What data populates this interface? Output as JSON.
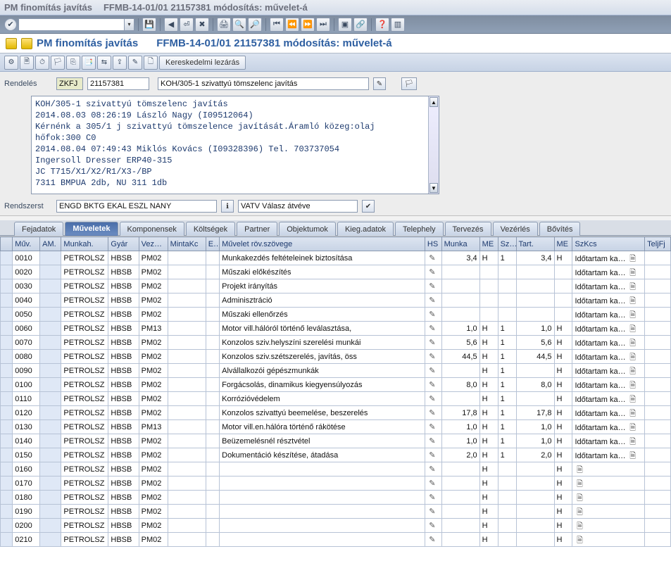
{
  "title": {
    "left": "PM finomítás javítás",
    "right": "FFMB-14-01/01 21157381 módosítás: művelet-á"
  },
  "screen": {
    "left": "PM finomítás javítás",
    "right": "FFMB-14-01/01 21157381 módosítás: művelet-á"
  },
  "toolbar2_text_btn": "Kereskedelmi lezárás",
  "order": {
    "label": "Rendelés",
    "type": "ZKFJ",
    "number": "21157381",
    "desc": "KOH/305-1 szivattyú tömszelenc javítás"
  },
  "longtext": "KOH/305-1 szivattyú tömszelenc javítás\n2014.08.03 08:26:19 László Nagy (I09512064)\nKérnénk a 305/1 j szivattyú tömszelence javítását.Áramló közeg:olaj\nhőfok:300 C0\n2014.08.04 07:49:43 Miklós Kovács (I09328396) Tel. 703737054\nIngersoll Dresser ERP40-315\nJC T715/X1/X2/R1/X3-/BP\n7311 BMPUA 2db, NU 311 1db",
  "system_row": {
    "label": "Rendszerst",
    "value": "ENGD BKTG EKAL ESZL NANY",
    "status": "VATV Válasz átvéve"
  },
  "tabs": [
    "Fejadatok",
    "Műveletek",
    "Komponensek",
    "Költségek",
    "Partner",
    "Objektumok",
    "Kieg.adatok",
    "Telephely",
    "Tervezés",
    "Vezérlés",
    "Bővítés"
  ],
  "tab_active": 1,
  "grid_headers": {
    "sel": "",
    "muv": "Műv.",
    "am": "AM.",
    "munkah": "Munkah.",
    "gyar": "Gyár",
    "vez": "Vez…",
    "mintakc": "MintaKc",
    "e": "E…",
    "szoveg": "Művelet röv.szövege",
    "hs": "HS",
    "munka": "Munka",
    "me1": "ME",
    "sz": "Sz…",
    "tart": "Tart.",
    "me2": "ME",
    "szkcs": "SzKcs",
    "teljfj": "TeljFj"
  },
  "rows": [
    {
      "muv": "0010",
      "munkah": "PETROLSZ",
      "gyar": "HBSB",
      "vez": "PM02",
      "szoveg": "Munkakezdés feltételeinek biztosítása",
      "munka": "3,4",
      "me1": "H",
      "sz": "1",
      "tart": "3,4",
      "me2": "H",
      "szkcs": "Időtartam ka…"
    },
    {
      "muv": "0020",
      "munkah": "PETROLSZ",
      "gyar": "HBSB",
      "vez": "PM02",
      "szoveg": "Műszaki előkészítés",
      "munka": "",
      "me1": "",
      "sz": "",
      "tart": "",
      "me2": "",
      "szkcs": "Időtartam ka…"
    },
    {
      "muv": "0030",
      "munkah": "PETROLSZ",
      "gyar": "HBSB",
      "vez": "PM02",
      "szoveg": "Projekt irányítás",
      "munka": "",
      "me1": "",
      "sz": "",
      "tart": "",
      "me2": "",
      "szkcs": "Időtartam ka…"
    },
    {
      "muv": "0040",
      "munkah": "PETROLSZ",
      "gyar": "HBSB",
      "vez": "PM02",
      "szoveg": "Adminisztráció",
      "munka": "",
      "me1": "",
      "sz": "",
      "tart": "",
      "me2": "",
      "szkcs": "Időtartam ka…"
    },
    {
      "muv": "0050",
      "munkah": "PETROLSZ",
      "gyar": "HBSB",
      "vez": "PM02",
      "szoveg": "Műszaki ellenőrzés",
      "munka": "",
      "me1": "",
      "sz": "",
      "tart": "",
      "me2": "",
      "szkcs": "Időtartam ka…"
    },
    {
      "muv": "0060",
      "munkah": "PETROLSZ",
      "gyar": "HBSB",
      "vez": "PM13",
      "szoveg": "Motor vill.hálóról történő leválasztása,",
      "munka": "1,0",
      "me1": "H",
      "sz": "1",
      "tart": "1,0",
      "me2": "H",
      "szkcs": "Időtartam ka…"
    },
    {
      "muv": "0070",
      "munkah": "PETROLSZ",
      "gyar": "HBSB",
      "vez": "PM02",
      "szoveg": "Konzolos sziv.helyszíni szerelési munkái",
      "munka": "5,6",
      "me1": "H",
      "sz": "1",
      "tart": "5,6",
      "me2": "H",
      "szkcs": "Időtartam ka…"
    },
    {
      "muv": "0080",
      "munkah": "PETROLSZ",
      "gyar": "HBSB",
      "vez": "PM02",
      "szoveg": "Konzolos sziv.szétszerelés, javítás, öss",
      "munka": "44,5",
      "me1": "H",
      "sz": "1",
      "tart": "44,5",
      "me2": "H",
      "szkcs": "Időtartam ka…"
    },
    {
      "muv": "0090",
      "munkah": "PETROLSZ",
      "gyar": "HBSB",
      "vez": "PM02",
      "szoveg": "Alvállalkozói gépészmunkák",
      "munka": "",
      "me1": "H",
      "sz": "1",
      "tart": "",
      "me2": "H",
      "szkcs": "Időtartam ka…"
    },
    {
      "muv": "0100",
      "munkah": "PETROLSZ",
      "gyar": "HBSB",
      "vez": "PM02",
      "szoveg": "Forgácsolás, dinamikus kiegyensúlyozás",
      "munka": "8,0",
      "me1": "H",
      "sz": "1",
      "tart": "8,0",
      "me2": "H",
      "szkcs": "Időtartam ka…"
    },
    {
      "muv": "0110",
      "munkah": "PETROLSZ",
      "gyar": "HBSB",
      "vez": "PM02",
      "szoveg": "Korrózióvédelem",
      "munka": "",
      "me1": "H",
      "sz": "1",
      "tart": "",
      "me2": "H",
      "szkcs": "Időtartam ka…"
    },
    {
      "muv": "0120",
      "munkah": "PETROLSZ",
      "gyar": "HBSB",
      "vez": "PM02",
      "szoveg": "Konzolos szivattyú beemelése, beszerelés",
      "munka": "17,8",
      "me1": "H",
      "sz": "1",
      "tart": "17,8",
      "me2": "H",
      "szkcs": "Időtartam ka…"
    },
    {
      "muv": "0130",
      "munkah": "PETROLSZ",
      "gyar": "HBSB",
      "vez": "PM13",
      "szoveg": "Motor vill.en.hálóra történő rákötése",
      "munka": "1,0",
      "me1": "H",
      "sz": "1",
      "tart": "1,0",
      "me2": "H",
      "szkcs": "Időtartam ka…"
    },
    {
      "muv": "0140",
      "munkah": "PETROLSZ",
      "gyar": "HBSB",
      "vez": "PM02",
      "szoveg": "Beüzemelésnél résztvétel",
      "munka": "1,0",
      "me1": "H",
      "sz": "1",
      "tart": "1,0",
      "me2": "H",
      "szkcs": "Időtartam ka…"
    },
    {
      "muv": "0150",
      "munkah": "PETROLSZ",
      "gyar": "HBSB",
      "vez": "PM02",
      "szoveg": "Dokumentáció készítése, átadása",
      "munka": "2,0",
      "me1": "H",
      "sz": "1",
      "tart": "2,0",
      "me2": "H",
      "szkcs": "Időtartam ka…"
    },
    {
      "muv": "0160",
      "munkah": "PETROLSZ",
      "gyar": "HBSB",
      "vez": "PM02",
      "szoveg": "",
      "munka": "",
      "me1": "H",
      "sz": "",
      "tart": "",
      "me2": "H",
      "szkcs": ""
    },
    {
      "muv": "0170",
      "munkah": "PETROLSZ",
      "gyar": "HBSB",
      "vez": "PM02",
      "szoveg": "",
      "munka": "",
      "me1": "H",
      "sz": "",
      "tart": "",
      "me2": "H",
      "szkcs": ""
    },
    {
      "muv": "0180",
      "munkah": "PETROLSZ",
      "gyar": "HBSB",
      "vez": "PM02",
      "szoveg": "",
      "munka": "",
      "me1": "H",
      "sz": "",
      "tart": "",
      "me2": "H",
      "szkcs": ""
    },
    {
      "muv": "0190",
      "munkah": "PETROLSZ",
      "gyar": "HBSB",
      "vez": "PM02",
      "szoveg": "",
      "munka": "",
      "me1": "H",
      "sz": "",
      "tart": "",
      "me2": "H",
      "szkcs": ""
    },
    {
      "muv": "0200",
      "munkah": "PETROLSZ",
      "gyar": "HBSB",
      "vez": "PM02",
      "szoveg": "",
      "munka": "",
      "me1": "H",
      "sz": "",
      "tart": "",
      "me2": "H",
      "szkcs": ""
    },
    {
      "muv": "0210",
      "munkah": "PETROLSZ",
      "gyar": "HBSB",
      "vez": "PM02",
      "szoveg": "",
      "munka": "",
      "me1": "H",
      "sz": "",
      "tart": "",
      "me2": "H",
      "szkcs": ""
    }
  ]
}
